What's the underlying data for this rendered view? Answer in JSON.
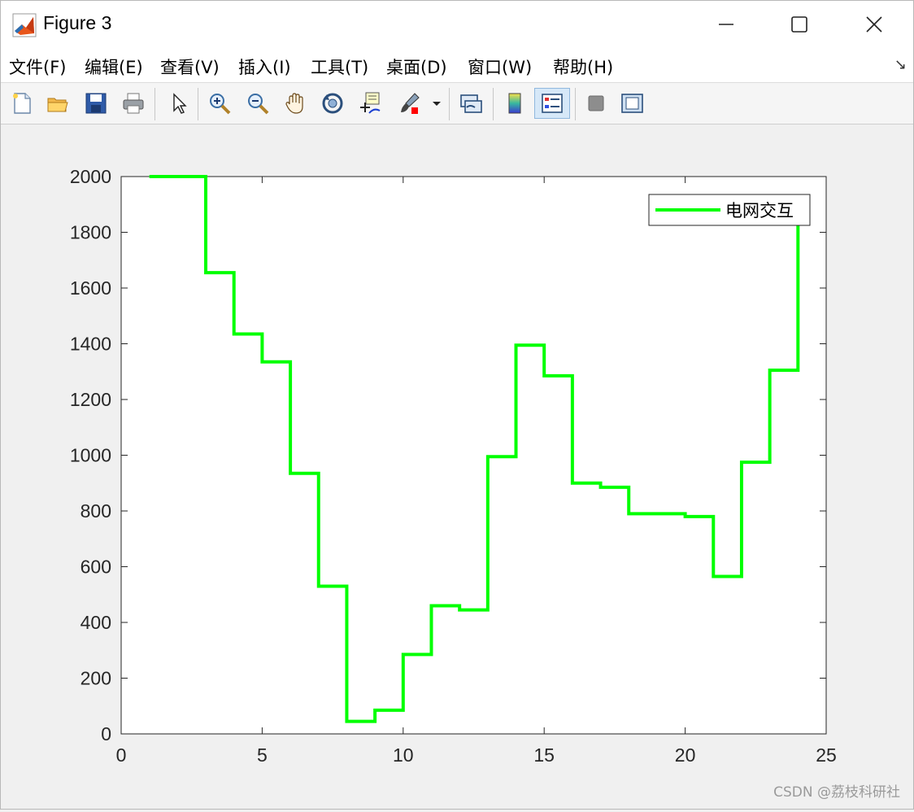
{
  "window": {
    "title": "Figure 3",
    "controls": [
      "minimize",
      "maximize",
      "close"
    ]
  },
  "menubar": {
    "items": [
      {
        "label": "文件(F)"
      },
      {
        "label": "编辑(E)"
      },
      {
        "label": "查看(V)"
      },
      {
        "label": "插入(I)"
      },
      {
        "label": "工具(T)"
      },
      {
        "label": "桌面(D)"
      },
      {
        "label": "窗口(W)"
      },
      {
        "label": "帮助(H)"
      }
    ]
  },
  "toolbar": {
    "buttons": [
      "new-figure-icon",
      "open-file-icon",
      "save-icon",
      "print-icon",
      "pointer-icon",
      "zoom-in-icon",
      "zoom-out-icon",
      "pan-hand-icon",
      "rotate-3d-icon",
      "data-cursor-icon",
      "brush-icon",
      "brush-dropdown-icon",
      "link-plot-icon",
      "colorbar-icon",
      "legend-icon",
      "hide-plot-tools-icon",
      "show-plot-tools-icon"
    ]
  },
  "chart_data": {
    "type": "line",
    "style": "stairs",
    "xlim": [
      0,
      25
    ],
    "ylim": [
      0,
      2000
    ],
    "xticks": [
      0,
      5,
      10,
      15,
      20,
      25
    ],
    "yticks": [
      0,
      200,
      400,
      600,
      800,
      1000,
      1200,
      1400,
      1600,
      1800,
      2000
    ],
    "grid": false,
    "legend_position": "top-right",
    "series": [
      {
        "name": "电网交互",
        "color": "#00ff00",
        "x": [
          1,
          2,
          3,
          4,
          5,
          6,
          7,
          8,
          9,
          10,
          11,
          12,
          13,
          14,
          15,
          16,
          17,
          18,
          19,
          20,
          21,
          22,
          23,
          24
        ],
        "values": [
          2000,
          2000,
          1655,
          1435,
          1335,
          935,
          530,
          45,
          85,
          285,
          460,
          445,
          995,
          1395,
          1285,
          900,
          885,
          790,
          790,
          780,
          565,
          975,
          1305,
          1850
        ]
      }
    ]
  },
  "watermark": "CSDN @荔枝科研社"
}
